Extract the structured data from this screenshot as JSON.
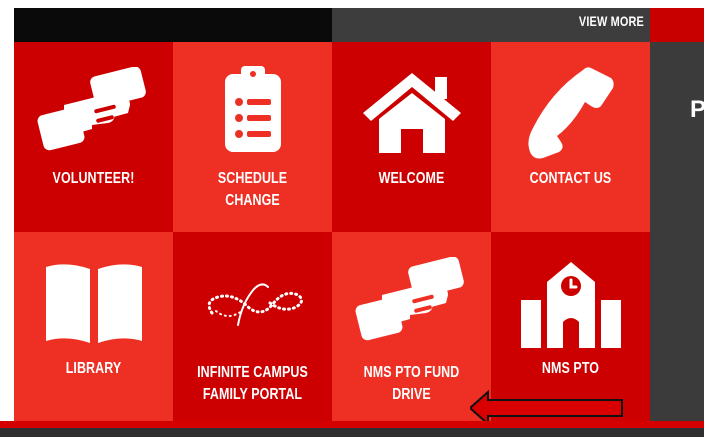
{
  "header": {
    "view_more_label": "VIEW MORE",
    "colors": {
      "black_bar": "#0a0a0a",
      "gray_bar": "#3d3d3d",
      "red_accent": "#c80000"
    }
  },
  "side_panel": {
    "partial_letter": "P"
  },
  "tiles": [
    {
      "label": "VOLUNTEER!",
      "icon": "handshake-icon",
      "shade": "dark"
    },
    {
      "label": "SCHEDULE CHANGE",
      "icon": "clipboard-list-icon",
      "shade": "light"
    },
    {
      "label": "WELCOME",
      "icon": "home-icon",
      "shade": "dark"
    },
    {
      "label": "CONTACT US",
      "icon": "phone-icon",
      "shade": "light"
    },
    {
      "label": "LIBRARY",
      "icon": "book-icon",
      "shade": "light"
    },
    {
      "label": "INFINITE CAMPUS\nFAMILY PORTAL",
      "icon": "infinity-icon",
      "shade": "dark"
    },
    {
      "label": "NMS PTO FUND\nDRIVE",
      "icon": "handshake-icon",
      "shade": "light"
    },
    {
      "label": "NMS PTO",
      "icon": "school-clock-icon",
      "shade": "dark"
    }
  ],
  "annotation": {
    "icon": "red-arrow-icon",
    "color": "#d80000"
  },
  "colors": {
    "tile_dark": "#cc0000",
    "tile_light": "#ee3024",
    "footer_red": "#d40000",
    "footer_dark": "#2f2f2f"
  }
}
